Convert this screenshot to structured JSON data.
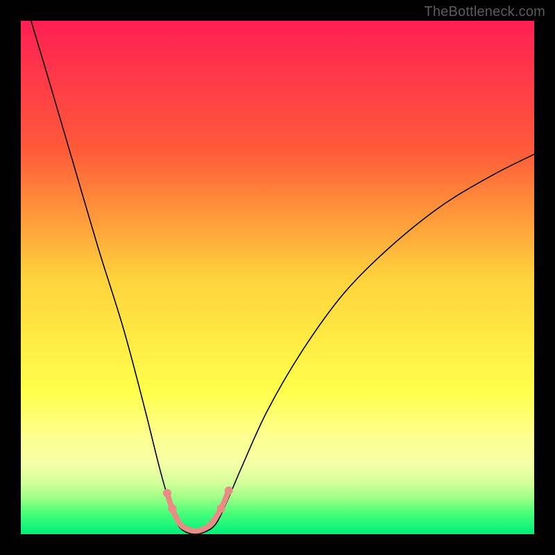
{
  "watermark": "TheBottleneck.com",
  "chart_data": {
    "type": "line",
    "title": "",
    "xlabel": "",
    "ylabel": "",
    "xlim": [
      0,
      100
    ],
    "ylim": [
      0,
      100
    ],
    "grid": false,
    "legend": false,
    "background_gradient_stops": [
      {
        "offset": 0,
        "color": "#ff1f53"
      },
      {
        "offset": 0.25,
        "color": "#ff5a3a"
      },
      {
        "offset": 0.5,
        "color": "#ffd23c"
      },
      {
        "offset": 0.72,
        "color": "#ffff4a"
      },
      {
        "offset": 0.8,
        "color": "#ffff8a"
      },
      {
        "offset": 0.86,
        "color": "#f7ffa6"
      },
      {
        "offset": 0.9,
        "color": "#d4ff9a"
      },
      {
        "offset": 0.93,
        "color": "#9cff86"
      },
      {
        "offset": 0.96,
        "color": "#46ff79"
      },
      {
        "offset": 1.0,
        "color": "#00f07a"
      }
    ],
    "series": [
      {
        "name": "bottleneck-curve",
        "color": "#000000",
        "width": 1.6,
        "data": [
          {
            "x": 2,
            "y": 100
          },
          {
            "x": 5,
            "y": 90
          },
          {
            "x": 10,
            "y": 73
          },
          {
            "x": 15,
            "y": 56
          },
          {
            "x": 20,
            "y": 40
          },
          {
            "x": 24,
            "y": 25
          },
          {
            "x": 27,
            "y": 13
          },
          {
            "x": 29,
            "y": 6
          },
          {
            "x": 30.5,
            "y": 2
          },
          {
            "x": 32,
            "y": 0.5
          },
          {
            "x": 34,
            "y": 0
          },
          {
            "x": 36,
            "y": 0.5
          },
          {
            "x": 38,
            "y": 2
          },
          {
            "x": 40,
            "y": 6
          },
          {
            "x": 43,
            "y": 13
          },
          {
            "x": 48,
            "y": 24
          },
          {
            "x": 55,
            "y": 36
          },
          {
            "x": 63,
            "y": 47
          },
          {
            "x": 72,
            "y": 56
          },
          {
            "x": 82,
            "y": 64
          },
          {
            "x": 92,
            "y": 70
          },
          {
            "x": 100,
            "y": 74
          }
        ]
      },
      {
        "name": "highlight-range",
        "color": "#e98c86",
        "width": 8,
        "data": [
          {
            "x": 28.5,
            "y": 8
          },
          {
            "x": 29.5,
            "y": 5
          },
          {
            "x": 31,
            "y": 2
          },
          {
            "x": 33,
            "y": 0.8
          },
          {
            "x": 35,
            "y": 0.8
          },
          {
            "x": 37,
            "y": 2
          },
          {
            "x": 39,
            "y": 5
          },
          {
            "x": 40.5,
            "y": 8.5
          }
        ]
      }
    ],
    "markers": [
      {
        "series": "highlight-range",
        "x": 28.5,
        "y": 8,
        "r": 6,
        "color": "#e98c86"
      },
      {
        "series": "highlight-range",
        "x": 29.5,
        "y": 5,
        "r": 6,
        "color": "#e98c86"
      },
      {
        "series": "highlight-range",
        "x": 39,
        "y": 5,
        "r": 6,
        "color": "#e98c86"
      },
      {
        "series": "highlight-range",
        "x": 40.5,
        "y": 8.5,
        "r": 6,
        "color": "#e98c86"
      }
    ]
  }
}
